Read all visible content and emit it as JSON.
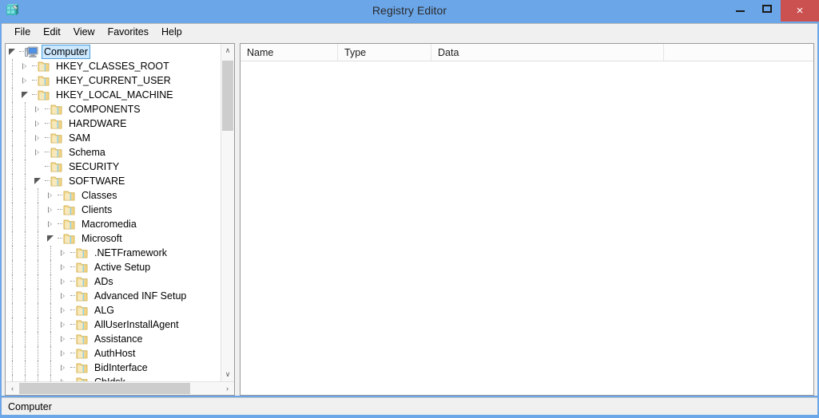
{
  "window": {
    "title": "Registry Editor",
    "icon": "registry-editor-icon",
    "accent_titlebar": "#6ba6e8",
    "close_button_color": "#cb5151",
    "controls": {
      "minimize": "minimize-icon",
      "maximize": "maximize-icon",
      "close": "×"
    }
  },
  "menubar": {
    "items": [
      {
        "label": "File"
      },
      {
        "label": "Edit"
      },
      {
        "label": "View"
      },
      {
        "label": "Favorites"
      },
      {
        "label": "Help"
      }
    ]
  },
  "tree": {
    "selected": "Computer",
    "nodes": [
      {
        "label": "Computer",
        "depth": 0,
        "state": "expanded",
        "icon": "computer-icon",
        "selected": true
      },
      {
        "label": "HKEY_CLASSES_ROOT",
        "depth": 1,
        "state": "collapsed",
        "icon": "registry-key-folder-icon",
        "selected": false
      },
      {
        "label": "HKEY_CURRENT_USER",
        "depth": 1,
        "state": "collapsed",
        "icon": "registry-key-folder-icon",
        "selected": false
      },
      {
        "label": "HKEY_LOCAL_MACHINE",
        "depth": 1,
        "state": "expanded",
        "icon": "registry-key-folder-icon",
        "selected": false
      },
      {
        "label": "COMPONENTS",
        "depth": 2,
        "state": "collapsed",
        "icon": "registry-key-folder-icon",
        "selected": false
      },
      {
        "label": "HARDWARE",
        "depth": 2,
        "state": "collapsed",
        "icon": "registry-key-folder-icon",
        "selected": false
      },
      {
        "label": "SAM",
        "depth": 2,
        "state": "collapsed",
        "icon": "registry-key-folder-icon",
        "selected": false
      },
      {
        "label": "Schema",
        "depth": 2,
        "state": "collapsed",
        "icon": "registry-key-folder-icon",
        "selected": false
      },
      {
        "label": "SECURITY",
        "depth": 2,
        "state": "leaf",
        "icon": "registry-key-folder-icon",
        "selected": false
      },
      {
        "label": "SOFTWARE",
        "depth": 2,
        "state": "expanded",
        "icon": "registry-key-folder-icon",
        "selected": false
      },
      {
        "label": "Classes",
        "depth": 3,
        "state": "collapsed",
        "icon": "registry-key-folder-icon",
        "selected": false
      },
      {
        "label": "Clients",
        "depth": 3,
        "state": "collapsed",
        "icon": "registry-key-folder-icon",
        "selected": false
      },
      {
        "label": "Macromedia",
        "depth": 3,
        "state": "collapsed",
        "icon": "registry-key-folder-icon",
        "selected": false
      },
      {
        "label": "Microsoft",
        "depth": 3,
        "state": "expanded",
        "icon": "registry-key-folder-icon",
        "selected": false
      },
      {
        "label": ".NETFramework",
        "depth": 4,
        "state": "collapsed",
        "icon": "registry-key-folder-icon",
        "selected": false
      },
      {
        "label": "Active Setup",
        "depth": 4,
        "state": "collapsed",
        "icon": "registry-key-folder-icon",
        "selected": false
      },
      {
        "label": "ADs",
        "depth": 4,
        "state": "collapsed",
        "icon": "registry-key-folder-icon",
        "selected": false
      },
      {
        "label": "Advanced INF Setup",
        "depth": 4,
        "state": "collapsed",
        "icon": "registry-key-folder-icon",
        "selected": false
      },
      {
        "label": "ALG",
        "depth": 4,
        "state": "collapsed",
        "icon": "registry-key-folder-icon",
        "selected": false
      },
      {
        "label": "AllUserInstallAgent",
        "depth": 4,
        "state": "collapsed",
        "icon": "registry-key-folder-icon",
        "selected": false
      },
      {
        "label": "Assistance",
        "depth": 4,
        "state": "collapsed",
        "icon": "registry-key-folder-icon",
        "selected": false
      },
      {
        "label": "AuthHost",
        "depth": 4,
        "state": "collapsed",
        "icon": "registry-key-folder-icon",
        "selected": false
      },
      {
        "label": "BidInterface",
        "depth": 4,
        "state": "collapsed",
        "icon": "registry-key-folder-icon",
        "selected": false
      },
      {
        "label": "CbIdsk",
        "depth": 4,
        "state": "collapsed",
        "icon": "registry-key-folder-icon",
        "selected": false
      }
    ],
    "vscroll": {
      "up_glyph": "∧",
      "down_glyph": "∨"
    },
    "hscroll": {
      "left_glyph": "‹",
      "right_glyph": "›"
    }
  },
  "values_pane": {
    "columns": [
      {
        "label": "Name"
      },
      {
        "label": "Type"
      },
      {
        "label": "Data"
      }
    ],
    "rows": []
  },
  "statusbar": {
    "path": "Computer"
  }
}
